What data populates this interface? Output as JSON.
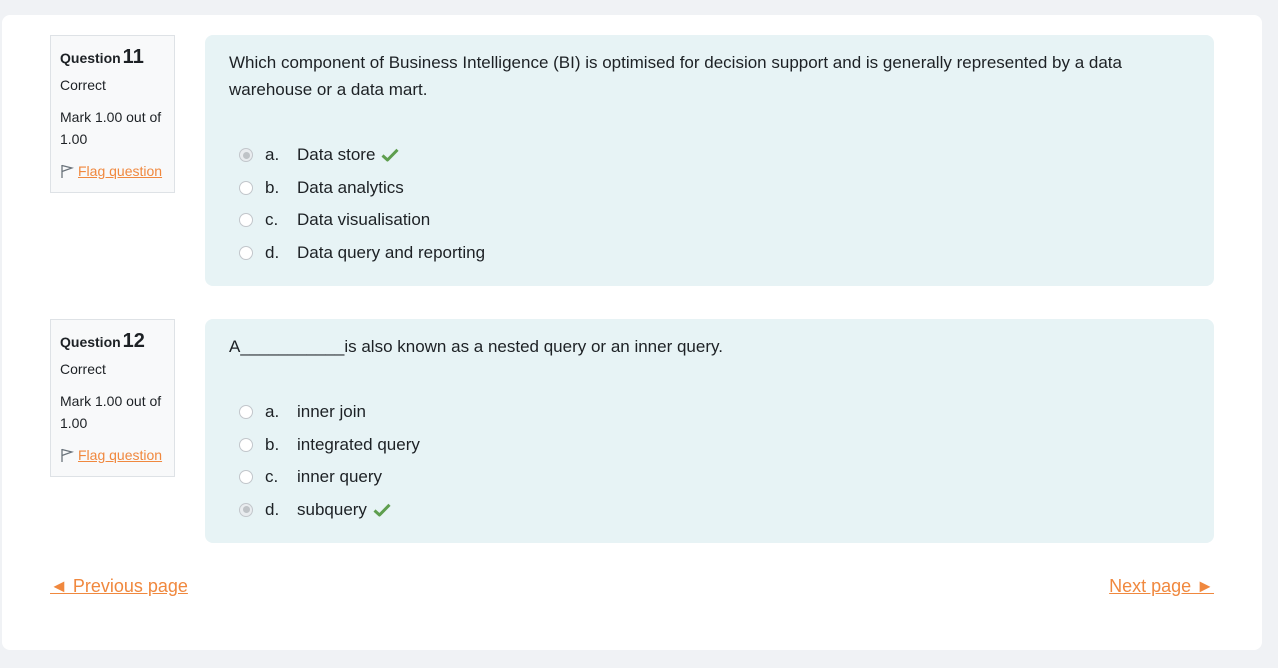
{
  "questions": [
    {
      "label": "Question",
      "number": "11",
      "state": "Correct",
      "grade": "Mark 1.00 out of 1.00",
      "flag_label": "Flag question",
      "text": "Which component of Business Intelligence (BI) is optimised for decision support and is generally represented by a data warehouse or a data mart.",
      "answers": [
        {
          "letter": "a.",
          "text": "Data store",
          "selected": true,
          "correct": true
        },
        {
          "letter": "b.",
          "text": "Data analytics",
          "selected": false,
          "correct": false
        },
        {
          "letter": "c.",
          "text": "Data visualisation",
          "selected": false,
          "correct": false
        },
        {
          "letter": "d.",
          "text": "Data query and reporting",
          "selected": false,
          "correct": false
        }
      ]
    },
    {
      "label": "Question",
      "number": "12",
      "state": "Correct",
      "grade": "Mark 1.00 out of 1.00",
      "flag_label": "Flag question",
      "text": "A___________is also known as a nested query or an inner query.",
      "answers": [
        {
          "letter": "a.",
          "text": "inner join",
          "selected": false,
          "correct": false
        },
        {
          "letter": "b.",
          "text": "integrated query",
          "selected": false,
          "correct": false
        },
        {
          "letter": "c.",
          "text": "inner query",
          "selected": false,
          "correct": false
        },
        {
          "letter": "d.",
          "text": "subquery",
          "selected": true,
          "correct": true
        }
      ]
    }
  ],
  "navigation": {
    "prev_label": "◄ Previous page",
    "next_label": "Next page ►"
  },
  "colors": {
    "link": "#f0883e",
    "check": "#5e9e4e",
    "question_bg": "#e7f3f5"
  },
  "icons": {
    "flag": "flag-icon",
    "correct": "check-icon"
  }
}
